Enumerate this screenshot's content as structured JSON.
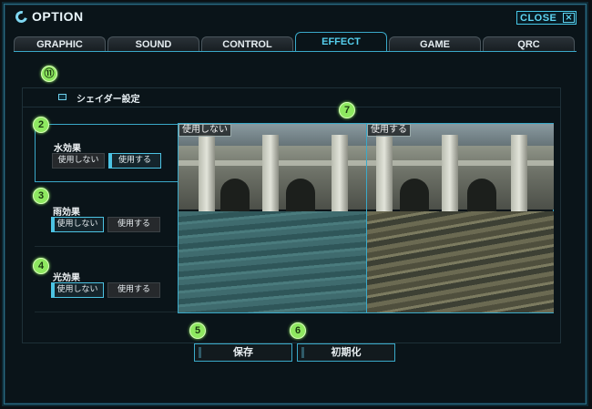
{
  "window": {
    "title": "OPTION",
    "close_label": "CLOSE",
    "close_icon": "x-icon"
  },
  "tabs": [
    {
      "label": "GRAPHIC",
      "active": false
    },
    {
      "label": "SOUND",
      "active": false
    },
    {
      "label": "CONTROL",
      "active": false
    },
    {
      "label": "EFFECT",
      "active": true
    },
    {
      "label": "GAME",
      "active": false
    },
    {
      "label": "QRC",
      "active": false
    }
  ],
  "markers": [
    "⑪",
    "2",
    "3",
    "4",
    "5",
    "6",
    "7"
  ],
  "shader_section": {
    "title": "シェイダー設定"
  },
  "options": [
    {
      "label": "水効果",
      "off_label": "使用しない",
      "on_label": "使用する",
      "selected": "on"
    },
    {
      "label": "雨効果",
      "off_label": "使用しない",
      "on_label": "使用する",
      "selected": "off"
    },
    {
      "label": "光効果",
      "off_label": "使用しない",
      "on_label": "使用する",
      "selected": "off"
    }
  ],
  "preview": {
    "left_label": "使用しない",
    "right_label": "使用する"
  },
  "footer": {
    "save_label": "保存",
    "reset_label": "初期化"
  },
  "colors": {
    "accent": "#3aa9c9",
    "marker": "#8ee860",
    "background": "#0a1419"
  }
}
